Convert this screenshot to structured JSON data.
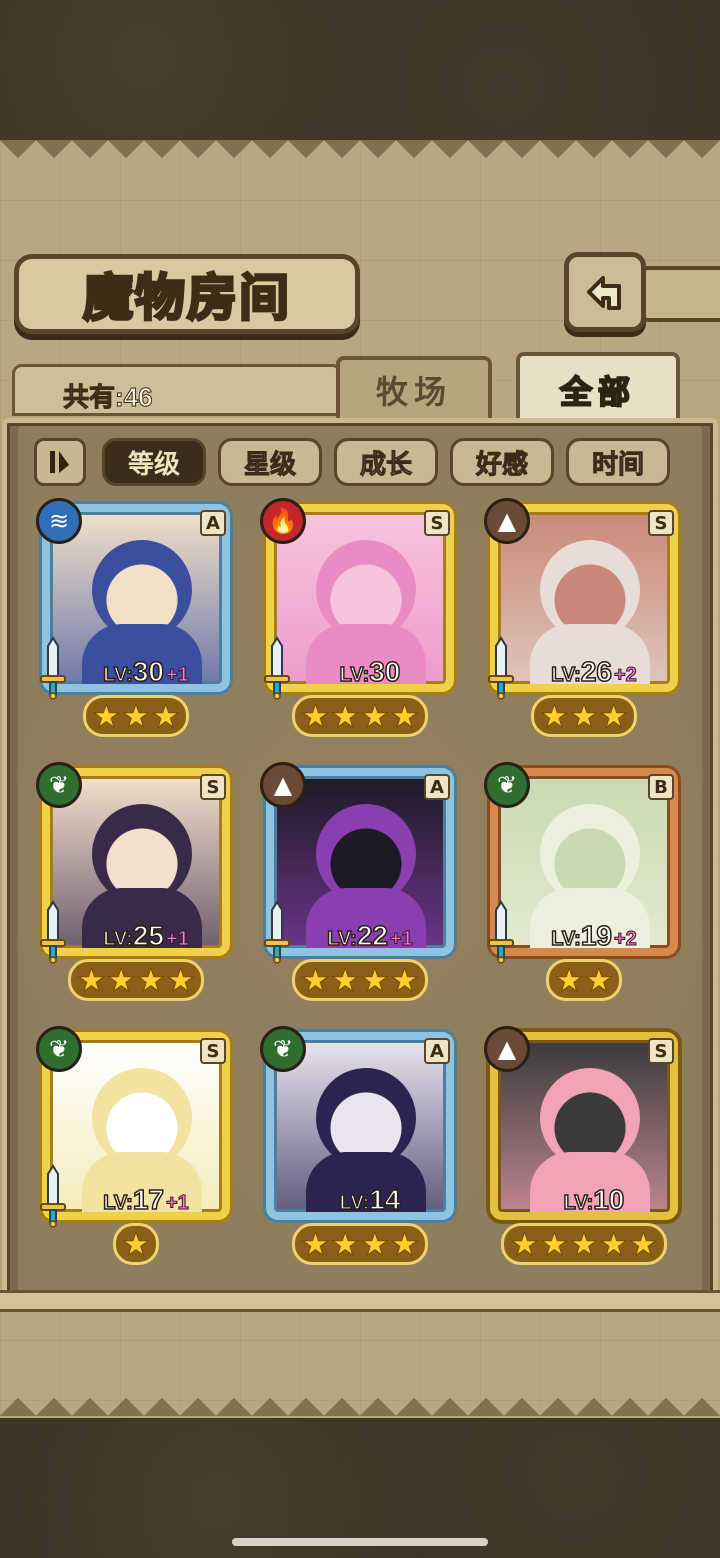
{
  "header": {
    "title": "魔物房间",
    "back_icon": "back-arrow-icon"
  },
  "summary": {
    "count_label": "共有:46"
  },
  "tabs": [
    {
      "label": "牧场",
      "active": false
    },
    {
      "label": "全部",
      "active": true
    }
  ],
  "filters": {
    "sort_toggle_icon": "sort-toggle-icon",
    "items": [
      {
        "label": "等级",
        "active": true
      },
      {
        "label": "星级",
        "active": false
      },
      {
        "label": "成长",
        "active": false
      },
      {
        "label": "好感",
        "active": false
      },
      {
        "label": "时间",
        "active": false
      }
    ]
  },
  "monsters": [
    {
      "element": "water",
      "rank": "A",
      "frame": "blue",
      "level_prefix": "LV:",
      "level": "30",
      "plus": "+1",
      "stars": 3,
      "weapon": "sword-icon",
      "palette": [
        "#3b4f9e",
        "#f2e0c8"
      ]
    },
    {
      "element": "fire",
      "rank": "S",
      "frame": "gold",
      "level_prefix": "LV:",
      "level": "30",
      "plus": "",
      "stars": 4,
      "weapon": "sword-icon",
      "palette": [
        "#e98cc4",
        "#f7c4de"
      ]
    },
    {
      "element": "earth",
      "rank": "S",
      "frame": "gold",
      "level_prefix": "LV:",
      "level": "26",
      "plus": "+2",
      "stars": 3,
      "weapon": "sword-icon",
      "palette": [
        "#e8ddd6",
        "#c9897a"
      ]
    },
    {
      "element": "wood",
      "rank": "S",
      "frame": "gold",
      "level_prefix": "LV:",
      "level": "25",
      "plus": "+1",
      "stars": 4,
      "weapon": "sword-icon",
      "palette": [
        "#3a2a4a",
        "#f3e0cc"
      ]
    },
    {
      "element": "earth",
      "rank": "A",
      "frame": "blue",
      "level_prefix": "LV:",
      "level": "22",
      "plus": "+1",
      "stars": 4,
      "weapon": "sword-icon",
      "palette": [
        "#8a3fb0",
        "#1c1a24"
      ]
    },
    {
      "element": "wood",
      "rank": "B",
      "frame": "bronze",
      "level_prefix": "LV:",
      "level": "19",
      "plus": "+2",
      "stars": 2,
      "weapon": "sword-icon",
      "palette": [
        "#eef0de",
        "#c9d9b2"
      ]
    },
    {
      "element": "wood",
      "rank": "S",
      "frame": "gold",
      "level_prefix": "LV:",
      "level": "17",
      "plus": "+1",
      "stars": 1,
      "weapon": "sword-icon",
      "palette": [
        "#f2e4a0",
        "#ffffff"
      ]
    },
    {
      "element": "wood",
      "rank": "A",
      "frame": "blue",
      "level_prefix": "LV:",
      "level": "14",
      "plus": "",
      "stars": 4,
      "weapon": "",
      "palette": [
        "#2c2450",
        "#e9e4f0"
      ]
    },
    {
      "element": "earth",
      "rank": "S",
      "frame": "ornate",
      "level_prefix": "LV:",
      "level": "10",
      "plus": "",
      "stars": 5,
      "weapon": "",
      "palette": [
        "#f2a4b4",
        "#3a3a3a"
      ]
    }
  ],
  "element_icons": {
    "water": "water-wave-icon",
    "fire": "flame-icon",
    "earth": "mountain-icon",
    "wood": "leaf-icon"
  },
  "element_glyphs": {
    "water": "≋",
    "fire": "🔥",
    "earth": "▲",
    "wood": "❦"
  }
}
